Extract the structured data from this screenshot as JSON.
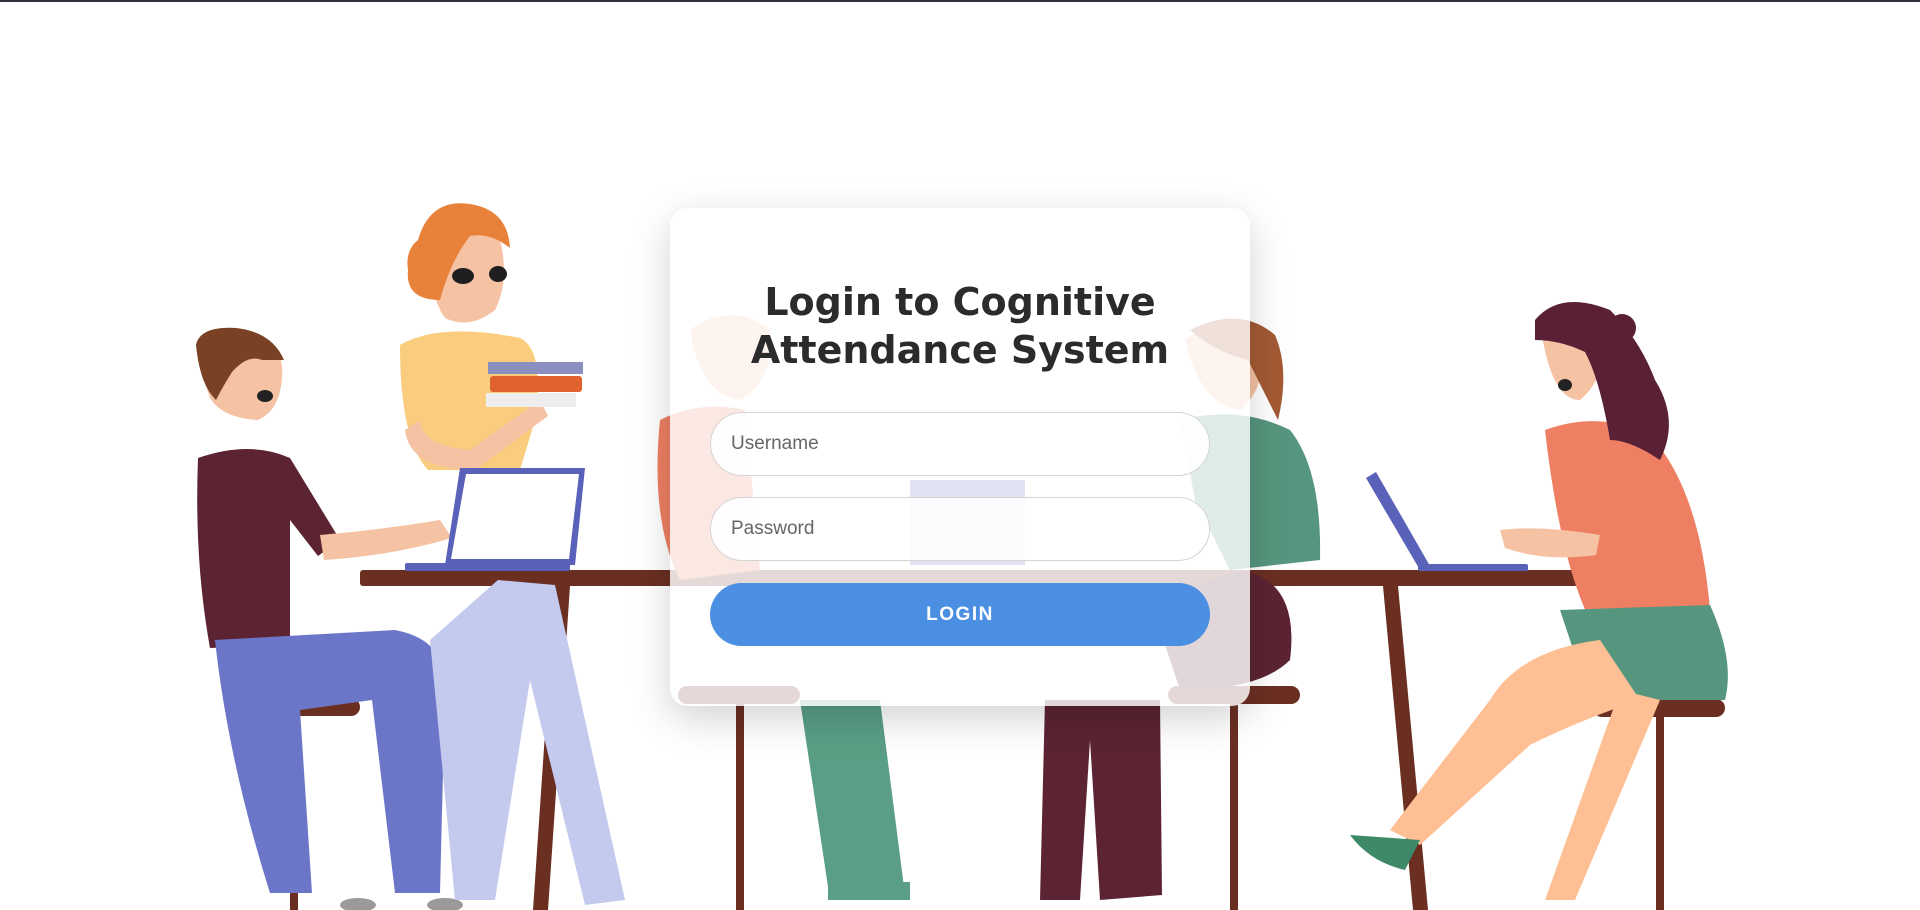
{
  "login": {
    "title": "Login to Cognitive Attendance System",
    "username_placeholder": "Username",
    "password_placeholder": "Password",
    "button_label": "LOGIN",
    "button_color": "#4a8fe2"
  },
  "illustration": {
    "subject": "people-working-at-table-illustration"
  }
}
